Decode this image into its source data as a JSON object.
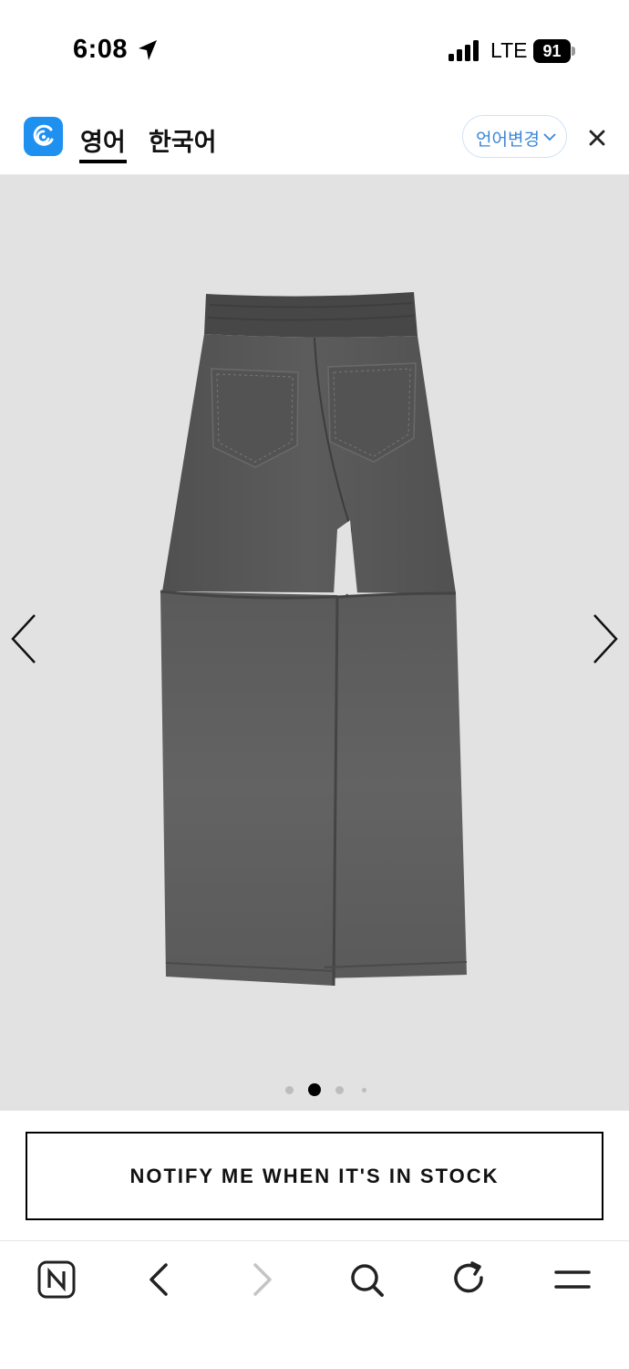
{
  "status_bar": {
    "time": "6:08",
    "network": "LTE",
    "battery": "91"
  },
  "translate_bar": {
    "tabs": [
      {
        "label": "영어",
        "active": true
      },
      {
        "label": "한국어",
        "active": false
      }
    ],
    "change_language_label": "언어변경",
    "accent_color": "#1e90f0"
  },
  "gallery": {
    "image_subject": "washed grey wide-leg pants, back view",
    "page_count": 4,
    "current_page": 2,
    "background_color": "#e2e2e2"
  },
  "notify_button": {
    "label": "NOTIFY ME WHEN IT'S IN STOCK"
  },
  "toolbar": {
    "items": [
      "naver-home-icon",
      "back-icon",
      "forward-icon",
      "search-icon",
      "reload-icon",
      "menu-icon"
    ]
  }
}
